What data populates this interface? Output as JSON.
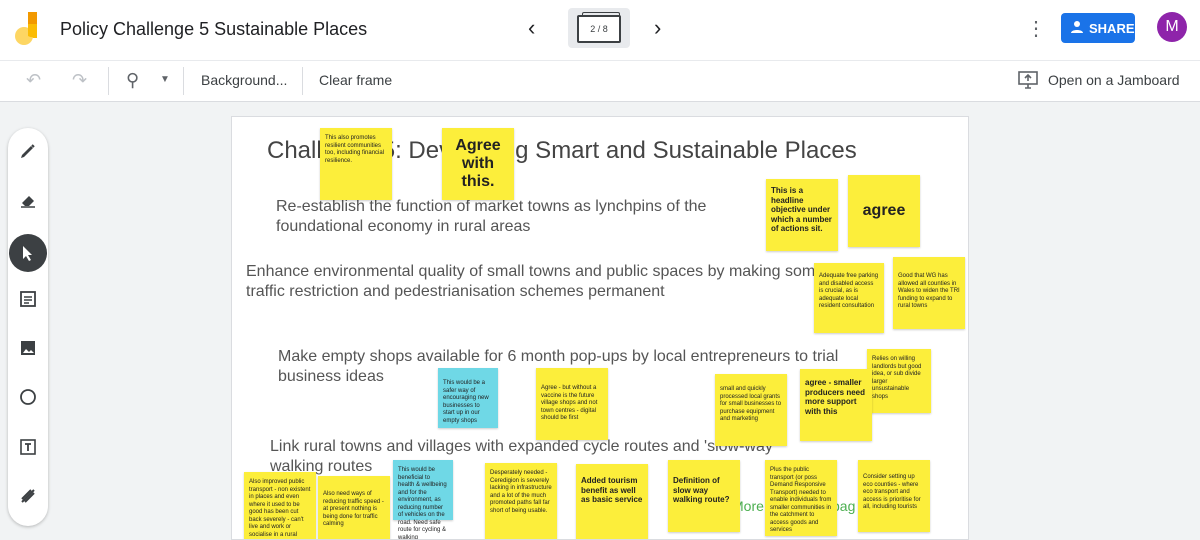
{
  "header": {
    "title": "Policy Challenge 5 Sustainable Places",
    "frame_indicator": "2 / 8",
    "share_label": "SHARE",
    "avatar_letter": "M"
  },
  "toolbar": {
    "background_label": "Background...",
    "clear_label": "Clear frame",
    "open_label": "Open on a Jamboard"
  },
  "canvas": {
    "heading": "Challenge 5: Developing Smart and Sustainable Places",
    "lines": [
      "Re-establish the function of market towns as lynchpins of the foundational economy in rural areas",
      "Enhance environmental quality of small towns and public spaces by making some traffic restriction and pedestrianisation schemes permanent",
      "Make empty shops available for 6 month pop-ups by local entrepreneurs to trial business ideas",
      "Link rural towns and villages with expanded cycle routes and 'slow-way' walking routes"
    ],
    "green_text_1": "More",
    "green_text_2": "bag"
  },
  "notes": [
    "This also promotes resilient communities too, including financial resilience.",
    "Agree with this.",
    "This is a headline objective under which a number of actions sit.",
    "agree",
    "Adequate free parking and disabled access is crucial, as is adequate local resident consultation",
    "Good that WG has allowed all counties in Wales to widen the TRI funding to expand to rural towns",
    "Relies on willing landlords but good idea, or sub divide larger unsustainable shops",
    "This would be a safer way of encouraging new businesses to start up in our empty shops",
    "Agree - but without a vaccine is the future village shops and not town centres - digital should be first",
    "small and quickly processed local grants for small businesses to purchase equipment and marketing",
    "agree - smaller producers need more support with this",
    "Also improved public transport - non existent in places and even where it used to be good has been cut back severely - can't live and work or socialise in a rural areas and depend on",
    "Also need ways of reducing traffic speed - at present nothing is being done for traffic calming",
    "This would be beneficial to health & wellbeing and for the environment, as reducing number of vehicles on the road. Need safe route for cycling & walking",
    "Desperately needed - Ceredigion is severely lacking in infrastructure and a lot of the much promoted paths fall far short of being usable.",
    "Added tourism benefit as well as basic service",
    "Definition of slow way walking route?",
    "Plus the public transport (or poss Demand Responsive Transport) needed to enable individuals from smaller communities in the catchment to access goods and services",
    "Consider setting up eco counties - where eco transport and access is prioritise for all, including tourists"
  ],
  "colors": {
    "sticky_yellow": "#fcee3b",
    "sticky_blue": "#6fd8e6",
    "share_blue": "#1a73e8",
    "avatar_purple": "#8e24aa"
  }
}
